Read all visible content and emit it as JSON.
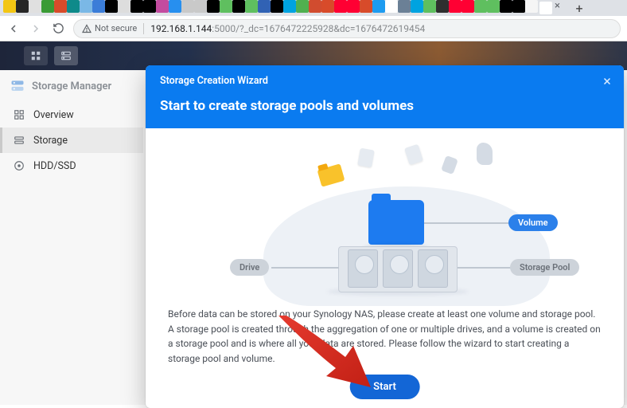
{
  "browser": {
    "url_host": "192.168.1.144",
    "url_rest": ":5000/?_dc=1676472225928&dc=1676472619454",
    "not_secure": "Not secure",
    "active_tab_close": "×",
    "new_tab": "+",
    "favicons": [
      "#f3c613",
      "#262626",
      "#e0e0e0",
      "#3a9b35",
      "#d84b2a",
      "#0e8a8a",
      "#7ab8e6",
      "#3b7dd8",
      "#000000",
      "#dddddd",
      "#000000",
      "#000000",
      "#c34b9f",
      "#278fef",
      "#c9c9c9",
      "#c9c9c9",
      "#000000",
      "#5fbf5f",
      "#000000",
      "#5fbf5f",
      "#3162b4",
      "#000000",
      "#00a3e0",
      "#50b04f",
      "#d14c2f",
      "#d84b2a",
      "#ff0033",
      "#ff0033",
      "#d84b2a",
      "#1d9bf0",
      "#ffffff",
      "#6b8096",
      "#00a3e0",
      "#5fbf5f",
      "#2f2f2f",
      "#ff0033",
      "#ff0033",
      "#5fbf5f",
      "#5fbf5f",
      "#000000",
      "#000000",
      "#f5f5f5"
    ]
  },
  "app": {
    "name": "Storage Manager",
    "sidebar": {
      "items": [
        {
          "label": "Overview"
        },
        {
          "label": "Storage"
        },
        {
          "label": "HDD/SSD"
        }
      ],
      "active_index": 1
    }
  },
  "wizard": {
    "caption": "Storage Creation Wizard",
    "title": "Start to create storage pools and volumes",
    "labels": {
      "volume": "Volume",
      "storage_pool": "Storage Pool",
      "drive": "Drive"
    },
    "description": "Before data can be stored on your Synology NAS, please create at least one volume and storage pool. A storage pool is created through the aggregation of one or multiple drives, and a volume is created on a storage pool and is where all your data are stored. Please follow the wizard to start creating a storage pool and volume.",
    "start": "Start"
  }
}
